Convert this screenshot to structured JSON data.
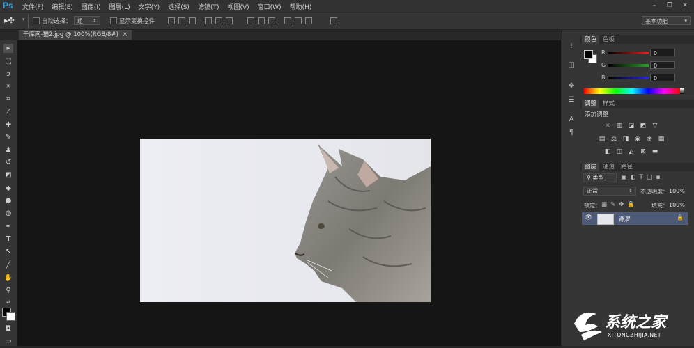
{
  "app_logo": "Ps",
  "menu": [
    "文件(F)",
    "编辑(E)",
    "图像(I)",
    "图层(L)",
    "文字(Y)",
    "选择(S)",
    "滤镜(T)",
    "视图(V)",
    "窗口(W)",
    "帮助(H)"
  ],
  "window_buttons": [
    "–",
    "❐",
    "✕"
  ],
  "options": {
    "auto_select_label": "自动选择：",
    "auto_select_value": "组",
    "show_transform_label": "显示变换控件",
    "workspace": "基本功能"
  },
  "document_tab": {
    "title": "千库网-猫2.jpg @ 100%(RGB/8#)",
    "close": "×"
  },
  "color_panel": {
    "tabs": [
      "颜色",
      "色板"
    ],
    "channels": [
      {
        "label": "R",
        "value": "0",
        "color": "#d42a2a"
      },
      {
        "label": "G",
        "value": "0",
        "color": "#2aa02a"
      },
      {
        "label": "B",
        "value": "0",
        "color": "#2a2ad4"
      }
    ]
  },
  "adjust_panel": {
    "tabs": [
      "调整",
      "样式"
    ],
    "title": "添加调整"
  },
  "layers_panel": {
    "tabs": [
      "图层",
      "通道",
      "路径"
    ],
    "filter_kind": "类型",
    "blend_mode": "正常",
    "opacity_label": "不透明度：",
    "opacity_value": "100%",
    "lock_label": "锁定：",
    "fill_label": "填充：",
    "fill_value": "100%",
    "layers": [
      {
        "name": "背景"
      }
    ]
  },
  "watermark": {
    "text": "系统之家",
    "url": "XITONGZHIJIA.NET"
  },
  "colors": {
    "accent": "#2fa3e6",
    "selected_layer": "#4d5a78"
  }
}
